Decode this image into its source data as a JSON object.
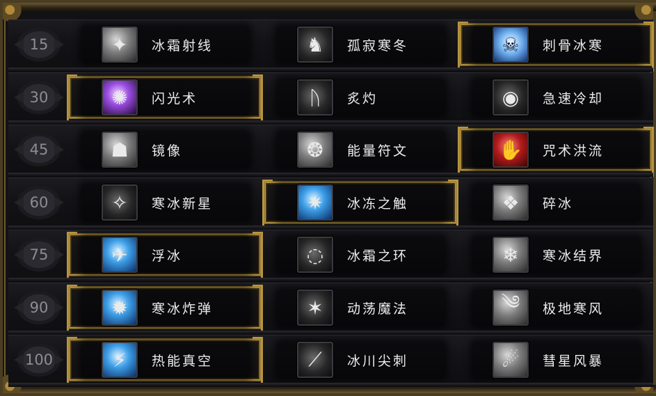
{
  "rows": [
    {
      "level": "15",
      "talents": [
        {
          "name": "冰霜射线",
          "icon": "frost-ray-icon",
          "glyph": "✦",
          "style": "gray",
          "selected": false
        },
        {
          "name": "孤寂寒冬",
          "icon": "lonely-winter-icon",
          "glyph": "♞",
          "style": "dark",
          "selected": false
        },
        {
          "name": "刺骨冰寒",
          "icon": "bone-chilling-icon",
          "glyph": "☠",
          "style": "skull",
          "selected": true
        }
      ]
    },
    {
      "level": "30",
      "talents": [
        {
          "name": "闪光术",
          "icon": "shimmer-icon",
          "glyph": "✺",
          "style": "purple",
          "selected": true
        },
        {
          "name": "炙灼",
          "icon": "mana-shield-icon",
          "glyph": "ᚢ",
          "style": "dark",
          "selected": false
        },
        {
          "name": "急速冷却",
          "icon": "cooldown-icon",
          "glyph": "◉",
          "style": "dark",
          "selected": false
        }
      ]
    },
    {
      "level": "45",
      "talents": [
        {
          "name": "镜像",
          "icon": "mirror-image-icon",
          "glyph": "☗",
          "style": "gray",
          "selected": false
        },
        {
          "name": "能量符文",
          "icon": "rune-of-power-icon",
          "glyph": "❂",
          "style": "gray",
          "selected": false
        },
        {
          "name": "咒术洪流",
          "icon": "incanters-flow-icon",
          "glyph": "✋",
          "style": "red",
          "selected": true
        }
      ]
    },
    {
      "level": "60",
      "talents": [
        {
          "name": "寒冰新星",
          "icon": "ice-nova-icon",
          "glyph": "✧",
          "style": "dark",
          "selected": false
        },
        {
          "name": "冰冻之触",
          "icon": "frozen-touch-icon",
          "glyph": "✷",
          "style": "blue",
          "selected": true
        },
        {
          "name": "碎冰",
          "icon": "splitting-ice-icon",
          "glyph": "❖",
          "style": "gray",
          "selected": false
        }
      ]
    },
    {
      "level": "75",
      "talents": [
        {
          "name": "浮冰",
          "icon": "ice-floes-icon",
          "glyph": "✈",
          "style": "blue",
          "selected": true
        },
        {
          "name": "冰霜之环",
          "icon": "ring-of-frost-icon",
          "glyph": "◌",
          "style": "dark",
          "selected": false
        },
        {
          "name": "寒冰结界",
          "icon": "ice-ward-icon",
          "glyph": "❄",
          "style": "gray",
          "selected": false
        }
      ]
    },
    {
      "level": "90",
      "talents": [
        {
          "name": "寒冰炸弹",
          "icon": "frost-bomb-icon",
          "glyph": "✹",
          "style": "blue",
          "selected": true
        },
        {
          "name": "动荡魔法",
          "icon": "unstable-magic-icon",
          "glyph": "✶",
          "style": "dark",
          "selected": false
        },
        {
          "name": "极地寒风",
          "icon": "arctic-gale-icon",
          "glyph": "༄",
          "style": "gray",
          "selected": false
        }
      ]
    },
    {
      "level": "100",
      "talents": [
        {
          "name": "热能真空",
          "icon": "thermal-void-icon",
          "glyph": "⚡",
          "style": "blue",
          "selected": true
        },
        {
          "name": "冰川尖刺",
          "icon": "glacial-spike-icon",
          "glyph": "⟋",
          "style": "dark",
          "selected": false
        },
        {
          "name": "彗星风暴",
          "icon": "comet-storm-icon",
          "glyph": "☄",
          "style": "gray",
          "selected": false
        }
      ]
    }
  ]
}
